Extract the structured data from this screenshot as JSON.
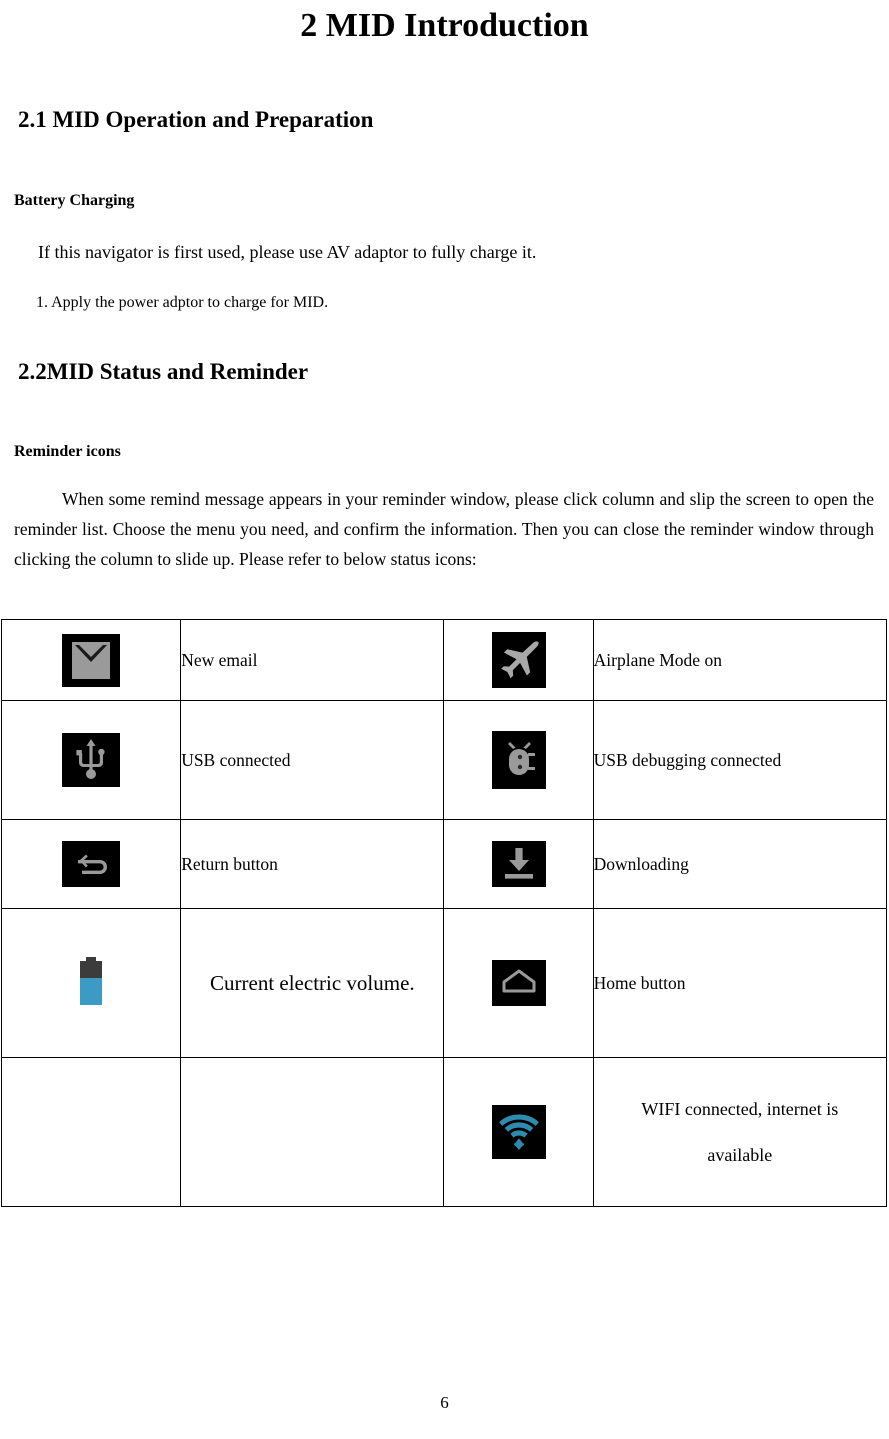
{
  "document": {
    "title": "2 MID Introduction",
    "page_number": "6"
  },
  "sections": [
    {
      "heading": "2.1 MID Operation and Preparation",
      "subheading": "Battery Charging",
      "intro": "If this navigator is first used, please use AV adaptor to fully charge it.",
      "step": "1. Apply the power adptor to charge for MID."
    },
    {
      "heading": "2.2MID Status and Reminder",
      "subheading": "Reminder icons",
      "body": "When some remind message appears in your reminder window, please click column and slip the screen to open the reminder list. Choose the menu you need, and confirm the information. Then you can close the reminder window through clicking the column to slide up. Please refer to below status icons:"
    }
  ],
  "status_icon_table": {
    "rows": [
      {
        "left_icon": "email-icon",
        "left_label": "New email",
        "right_icon": "airplane-icon",
        "right_label": "Airplane Mode on"
      },
      {
        "left_icon": "usb-icon",
        "left_label": "USB connected",
        "right_icon": "usb-debug-bug-icon",
        "right_label": "USB debugging connected"
      },
      {
        "left_icon": "return-arrow-icon",
        "left_label": "Return button",
        "right_icon": "download-icon",
        "right_label": "Downloading"
      },
      {
        "left_icon": "battery-icon",
        "left_label": "Current electric volume.",
        "right_icon": "home-icon",
        "right_label": "Home button"
      },
      {
        "left_icon": "",
        "left_label": "",
        "right_icon": "wifi-icon",
        "right_label_line1": "WIFI connected, internet is",
        "right_label_line2": "available"
      }
    ]
  },
  "colors": {
    "icon_tile_background": "#000000",
    "icon_glyph_gray": "#9a9a9a",
    "icon_glyph_light": "#b3b3b3",
    "battery_top": "#3c3c3c",
    "battery_fill": "#3b9bc4",
    "wifi_blue": "#2e8bb0",
    "text": "#000000",
    "table_border": "#000000"
  }
}
